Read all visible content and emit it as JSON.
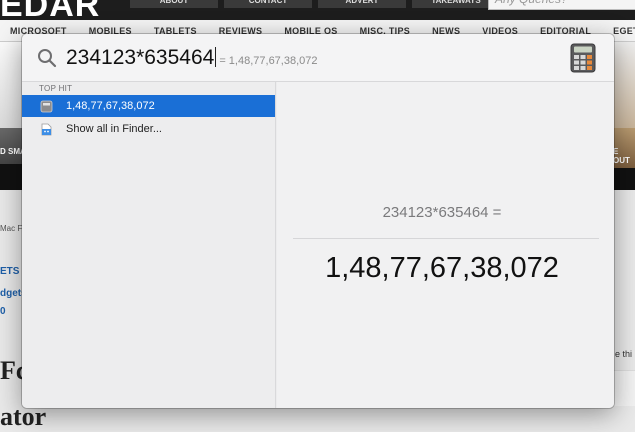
{
  "website": {
    "logo": "EDAR",
    "top_nav": [
      "ABOUT",
      "CONTACT",
      "ADVERT",
      "TAKEAWAYS"
    ],
    "search_placeholder": "Any Queries?",
    "nav": [
      "MICROSOFT",
      "MOBILES",
      "TABLETS",
      "REVIEWS",
      "MOBILE OS",
      "MISC. TIPS",
      "NEWS",
      "VIDEOS",
      "EDITORIAL",
      "EGET"
    ],
    "gallery_caption_left": "D SMA",
    "gallery_caption_right": "E OUT",
    "sidebar_text_1": "Mac F",
    "sidebar_text_2": "ETS",
    "sidebar_text_3": "dgets",
    "sidebar_text_4": "0",
    "footer_text_1": "Fc",
    "footer_text_2": "ator",
    "right_text": "e thi"
  },
  "spotlight": {
    "query": "234123*635464",
    "inline_result": "= 1,48,77,67,38,072",
    "section_header": "TOP HIT",
    "results": [
      {
        "label": "1,48,77,67,38,072",
        "icon": "calculator-icon",
        "selected": true
      },
      {
        "label": "Show all in Finder...",
        "icon": "finder-icon",
        "selected": false
      }
    ],
    "preview": {
      "expression": "234123*635464 =",
      "result": "1,48,77,67,38,072"
    }
  },
  "colors": {
    "selection": "#1a6fd6",
    "site_header": "#1d1d1d",
    "panel": "#ececed"
  }
}
